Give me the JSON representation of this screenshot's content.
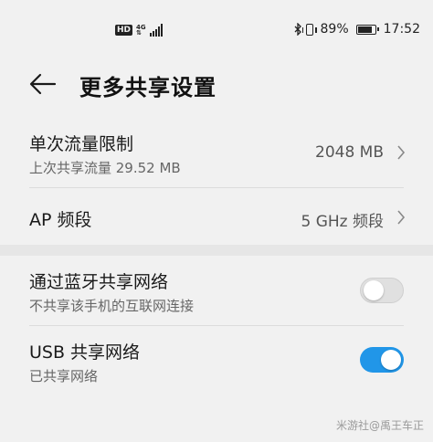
{
  "status_bar": {
    "hd": "HD",
    "net_top": "4G",
    "net_bottom": "⇅",
    "battery_percent": "89%",
    "time": "17:52"
  },
  "header": {
    "title": "更多共享设置"
  },
  "settings": {
    "traffic_limit": {
      "label": "单次流量限制",
      "sub": "上次共享流量 29.52 MB",
      "value": "2048 MB"
    },
    "ap_band": {
      "label": "AP 频段",
      "value": "5 GHz 频段"
    },
    "bluetooth_share": {
      "label": "通过蓝牙共享网络",
      "sub": "不共享该手机的互联网连接",
      "enabled": false
    },
    "usb_share": {
      "label": "USB 共享网络",
      "sub": "已共享网络",
      "enabled": true
    }
  },
  "watermark": "米游社@禹王车正",
  "colors": {
    "accent": "#2196e8",
    "background": "#f1f1f1"
  }
}
